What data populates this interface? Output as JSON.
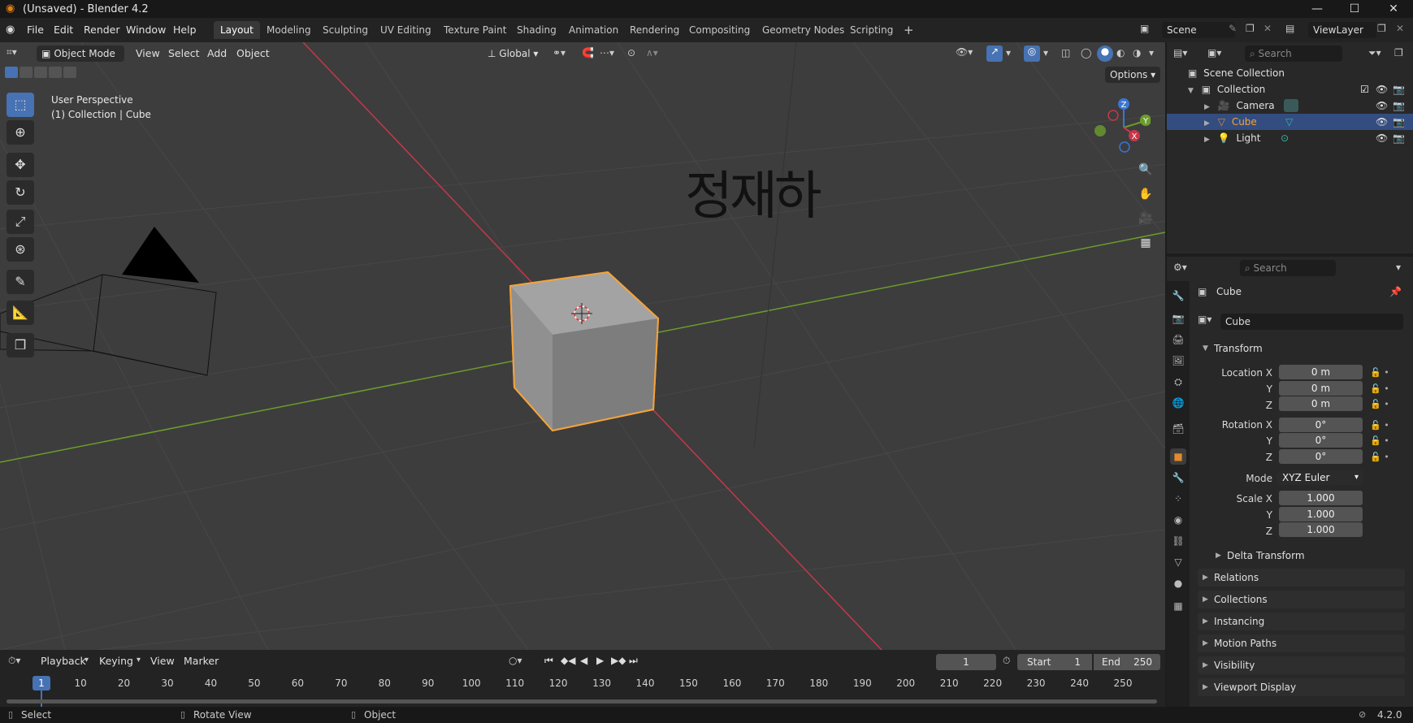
{
  "app": {
    "title": "(Unsaved) - Blender 4.2",
    "version": "4.2.0"
  },
  "menus": [
    "File",
    "Edit",
    "Render",
    "Window",
    "Help"
  ],
  "workspaces": [
    "Layout",
    "Modeling",
    "Sculpting",
    "UV Editing",
    "Texture Paint",
    "Shading",
    "Animation",
    "Rendering",
    "Compositing",
    "Geometry Nodes",
    "Scripting"
  ],
  "active_workspace": "Layout",
  "scene": {
    "scene_name": "Scene",
    "view_layer": "ViewLayer"
  },
  "viewport": {
    "mode": "Object Mode",
    "menus": [
      "View",
      "Select",
      "Add",
      "Object"
    ],
    "transform_orientation": "Global",
    "options_label": "Options",
    "overlay_line1": "User Perspective",
    "overlay_line2": "(1) Collection | Cube",
    "annotation_text": "정재하",
    "gizmo_axes": {
      "x": "X",
      "y": "Y",
      "z": "Z"
    },
    "colors": {
      "x_axis": "#c4384a",
      "y_axis": "#6c9c2c",
      "z_axis": "#3a76d4",
      "selection": "#f5a33a",
      "background": "#3d3d3d"
    }
  },
  "outliner": {
    "search_placeholder": "Search",
    "root": "Scene Collection",
    "collection": "Collection",
    "items": [
      {
        "name": "Camera",
        "selected": false
      },
      {
        "name": "Cube",
        "selected": true
      },
      {
        "name": "Light",
        "selected": false
      }
    ]
  },
  "properties": {
    "search_placeholder": "Search",
    "object_title": "Cube",
    "object_name": "Cube",
    "transform_label": "Transform",
    "location_label": "Location X",
    "rotation_label": "Rotation X",
    "scale_label": "Scale X",
    "axis_y": "Y",
    "axis_z": "Z",
    "location": [
      "0 m",
      "0 m",
      "0 m"
    ],
    "rotation": [
      "0°",
      "0°",
      "0°"
    ],
    "mode_label": "Mode",
    "mode_value": "XYZ Euler",
    "scale": [
      "1.000",
      "1.000",
      "1.000"
    ],
    "subpanels": [
      "Delta Transform"
    ],
    "panels": [
      "Relations",
      "Collections",
      "Instancing",
      "Motion Paths",
      "Visibility",
      "Viewport Display"
    ]
  },
  "timeline": {
    "menus": [
      "Playback",
      "Keying",
      "View",
      "Marker"
    ],
    "current_frame": "1",
    "start_label": "Start",
    "start": "1",
    "end_label": "End",
    "end": "250",
    "ticks": [
      "1",
      "10",
      "20",
      "30",
      "40",
      "50",
      "60",
      "70",
      "80",
      "90",
      "100",
      "110",
      "120",
      "130",
      "140",
      "150",
      "160",
      "170",
      "180",
      "190",
      "200",
      "210",
      "220",
      "230",
      "240",
      "250"
    ]
  },
  "statusbar": {
    "items": [
      "Select",
      "Rotate View",
      "Object"
    ]
  }
}
